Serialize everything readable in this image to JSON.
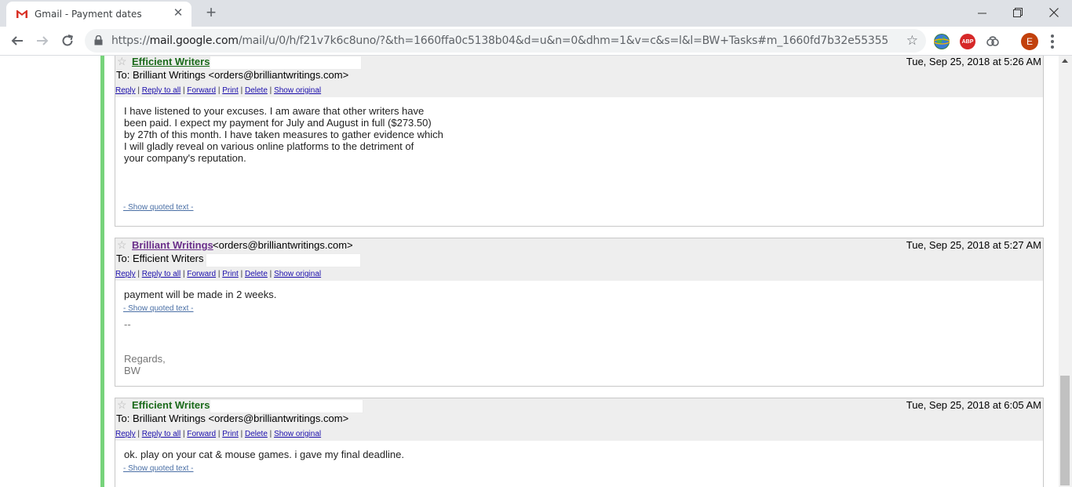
{
  "browser": {
    "tab_title": "Gmail - Payment dates",
    "tab_close": "✕",
    "new_tab": "+",
    "url_prefix": "https://",
    "url_host": "mail.google.com",
    "url_path": "/mail/u/0/h/f21v7k6c8uno/?&th=1660ffa0c5138b04&d=u&n=0&dhm=1&v=c&s=l&l=BW+Tasks#m_1660fd7b32e55355",
    "bookmark_icon": "star-outline-icon",
    "extensions": [
      "earth-extension-icon",
      "adblock-plus-icon",
      "extension-icon"
    ],
    "abp_label": "ABP",
    "profile_initial": "E"
  },
  "actions": {
    "reply": "Reply",
    "reply_all": "Reply to all",
    "forward": "Forward",
    "print": "Print",
    "delete": "Delete",
    "show_original": "Show original",
    "separator": "|"
  },
  "messages": [
    {
      "sender": "Efficient Writers",
      "sender_email": "",
      "to_label": "To:",
      "to": "Brilliant Writings <orders@brilliantwritings.com>",
      "date": "Tue, Sep 25, 2018 at 5:26 AM",
      "body": "I have listened to your excuses. I am aware that other writers have\nbeen paid. I expect my payment for July and August in full ($273.50)\nby 27th of this month. I have taken measures to gather evidence which\nI will gladly reveal on various online platforms to the detriment of\nyour company's reputation.",
      "quoted": "- Show quoted text -"
    },
    {
      "sender": "Brilliant Writings",
      "sender_email": "<orders@brilliantwritings.com>",
      "to_label": "To:",
      "to": "Efficient Writers",
      "date": "Tue, Sep 25, 2018 at 5:27 AM",
      "body": "payment will be made in 2 weeks.",
      "quoted": "- Show quoted text -",
      "sig_dash": "--",
      "signature": "Regards,\nBW"
    },
    {
      "sender": "Efficient Writers",
      "sender_email": "",
      "to_label": "To:",
      "to": "Brilliant Writings <orders@brilliantwritings.com>",
      "date": "Tue, Sep 25, 2018 at 6:05 AM",
      "body": "ok. play on your cat & mouse games. i gave my final deadline.",
      "quoted": "- Show quoted text -"
    }
  ],
  "colors": {
    "thread_bar": "#77d37b",
    "header_bg": "#eeeeee",
    "link": "#1a0dab",
    "sender_green": "#1a6a1a",
    "sender_visited": "#6a2f8a"
  }
}
